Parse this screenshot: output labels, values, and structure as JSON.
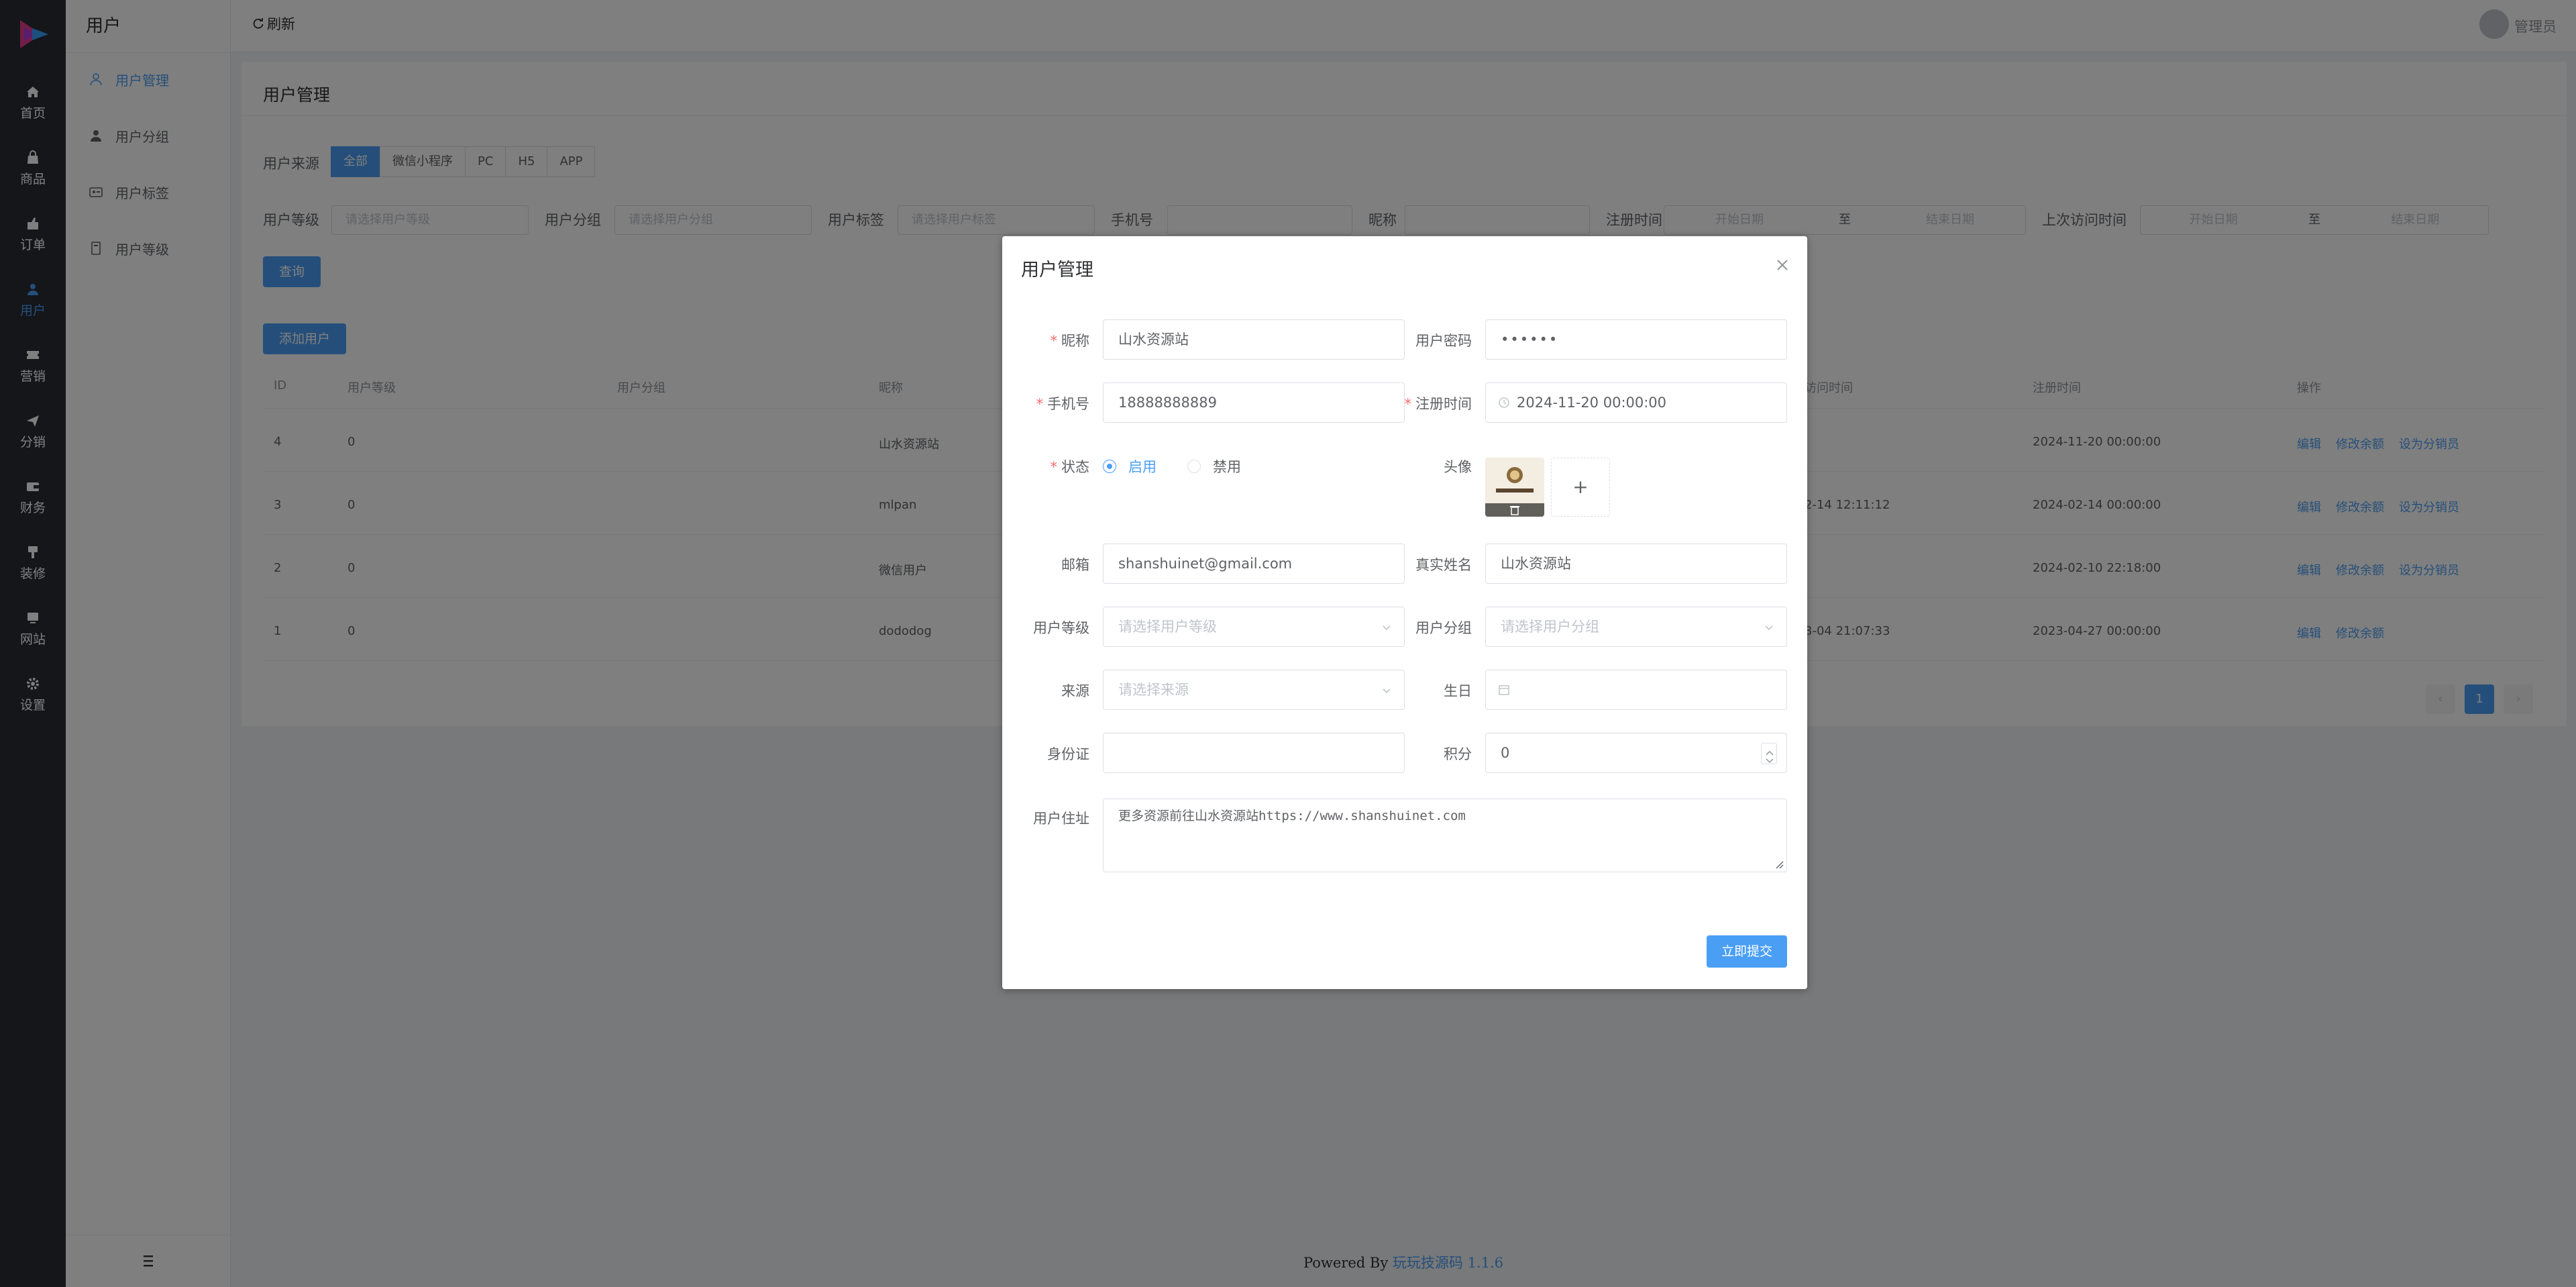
{
  "app": {
    "submenu_title": "用户",
    "refresh_label": "刷新",
    "user_name": "管理员",
    "footer_prefix": "Powered By ",
    "footer_link": "玩玩技源码 1.1.6"
  },
  "rail": [
    "首页",
    "商品",
    "订单",
    "用户",
    "营销",
    "分销",
    "财务",
    "装修",
    "网站",
    "设置"
  ],
  "submenu": [
    "用户管理",
    "用户分组",
    "用户标签",
    "用户等级"
  ],
  "page": {
    "title": "用户管理",
    "source_label": "用户来源",
    "sources": [
      "全部",
      "微信小程序",
      "PC",
      "H5",
      "APP"
    ],
    "filters": {
      "level_label": "用户等级",
      "level_ph": "请选择用户等级",
      "group_label": "用户分组",
      "group_ph": "请选择用户分组",
      "tag_label": "用户标签",
      "tag_ph": "请选择用户标签",
      "phone_label": "手机号",
      "nick_label": "昵称",
      "reg_label": "注册时间",
      "start_ph": "开始日期",
      "to": "至",
      "end_ph": "结束日期",
      "visit_label": "上次访问时间",
      "visit_start_ph": "开始日期",
      "visit_to": "至",
      "visit_end_ph": "结束日期"
    },
    "query_btn": "查询",
    "add_btn": "添加用户",
    "columns": [
      "ID",
      "用户等级",
      "用户分组",
      "昵称",
      "访问时间",
      "注册时间",
      "操作"
    ],
    "rows": [
      {
        "id": "4",
        "level": "0",
        "nick": "山水资源站",
        "visit": "",
        "reg": "2024-11-20 00:00:00",
        "ops": [
          "编辑",
          "修改余额",
          "设为分销员"
        ]
      },
      {
        "id": "3",
        "level": "0",
        "nick": "mlpan",
        "visit": "2-14 12:11:12",
        "reg": "2024-02-14 00:00:00",
        "ops": [
          "编辑",
          "修改余额",
          "设为分销员"
        ]
      },
      {
        "id": "2",
        "level": "0",
        "nick": "微信用户",
        "visit": "",
        "reg": "2024-02-10 22:18:00",
        "ops": [
          "编辑",
          "修改余额",
          "设为分销员"
        ]
      },
      {
        "id": "1",
        "level": "0",
        "nick": "dododog",
        "visit": "3-04 21:07:33",
        "reg": "2023-04-27 00:00:00",
        "ops": [
          "编辑",
          "修改余额"
        ]
      }
    ],
    "pager": {
      "prev": "‹",
      "current": "1",
      "next": "›"
    }
  },
  "dialog": {
    "title": "用户管理",
    "nickname_label": "昵称",
    "nickname_value": "山水资源站",
    "password_label": "用户密码",
    "password_value": "••••••",
    "phone_label": "手机号",
    "phone_value": "18888888889",
    "regtime_label": "注册时间",
    "regtime_value": "2024-11-20 00:00:00",
    "status_label": "状态",
    "status_on": "启用",
    "status_off": "禁用",
    "avatar_label": "头像",
    "upload_plus": "+",
    "email_label": "邮箱",
    "email_value": "shanshuinet@gmail.com",
    "realname_label": "真实姓名",
    "realname_value": "山水资源站",
    "level_label": "用户等级",
    "level_ph": "请选择用户等级",
    "group_label": "用户分组",
    "group_ph": "请选择用户分组",
    "source_label": "来源",
    "source_ph": "请选择来源",
    "birthday_label": "生日",
    "idcard_label": "身份证",
    "points_label": "积分",
    "points_value": "0",
    "address_label": "用户住址",
    "address_text_cn": "更多资源前往山水资源站",
    "address_text_url": "https://www.shanshuinet.com",
    "submit": "立即提交"
  }
}
